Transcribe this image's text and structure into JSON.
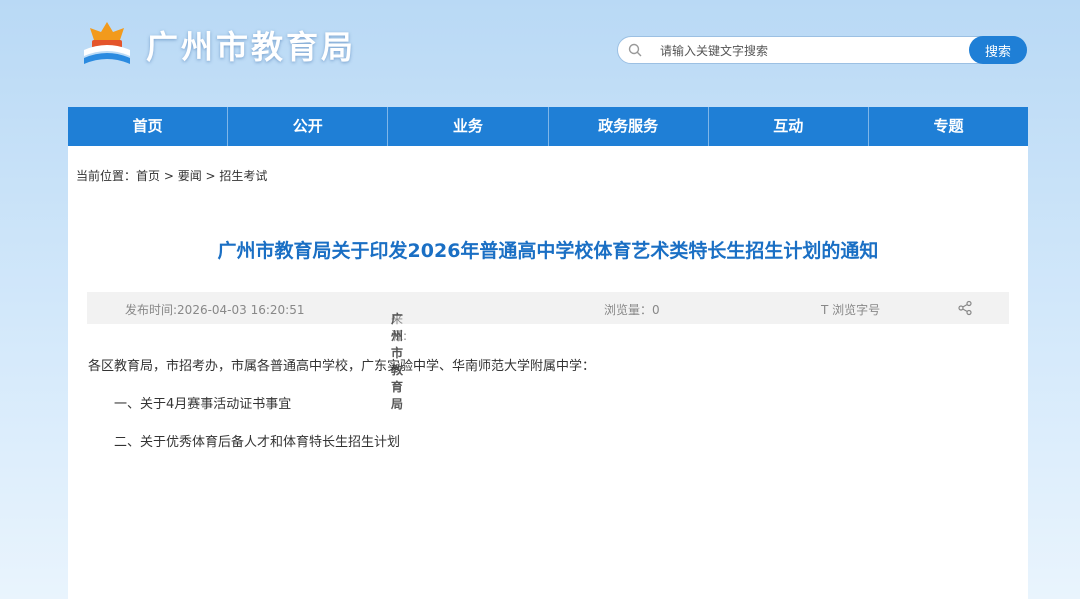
{
  "header": {
    "site_title": "广州市教育局",
    "search_placeholder": "请输入关键文字搜索",
    "search_button": "搜索"
  },
  "nav": [
    "首页",
    "公开",
    "业务",
    "政务服务",
    "互动",
    "专题"
  ],
  "breadcrumb": {
    "prefix": "当前位置：",
    "items": [
      "首页",
      "要闻",
      "招生考试"
    ],
    "separator": " > "
  },
  "article": {
    "title": "广州市教育局关于印发2026年普通高中学校体育艺术类特长生招生计划的通知",
    "meta": {
      "published": "发布时间:2026-04-03 16:20:51",
      "source_label": "来源:",
      "source_value": "广州市教育局",
      "views": "浏览量：0",
      "font_size": "T  浏览字号"
    },
    "paragraphs": [
      "各区教育局，市招考办，市属各普通高中学校，广东实验中学、华南师范大学附属中学：",
      "一、关于4月赛事活动证书事宜",
      "二、关于优秀体育后备人才和体育特长生招生计划"
    ]
  },
  "colors": {
    "nav_bg": "#1f7fd6",
    "title": "#1a6fc4"
  }
}
